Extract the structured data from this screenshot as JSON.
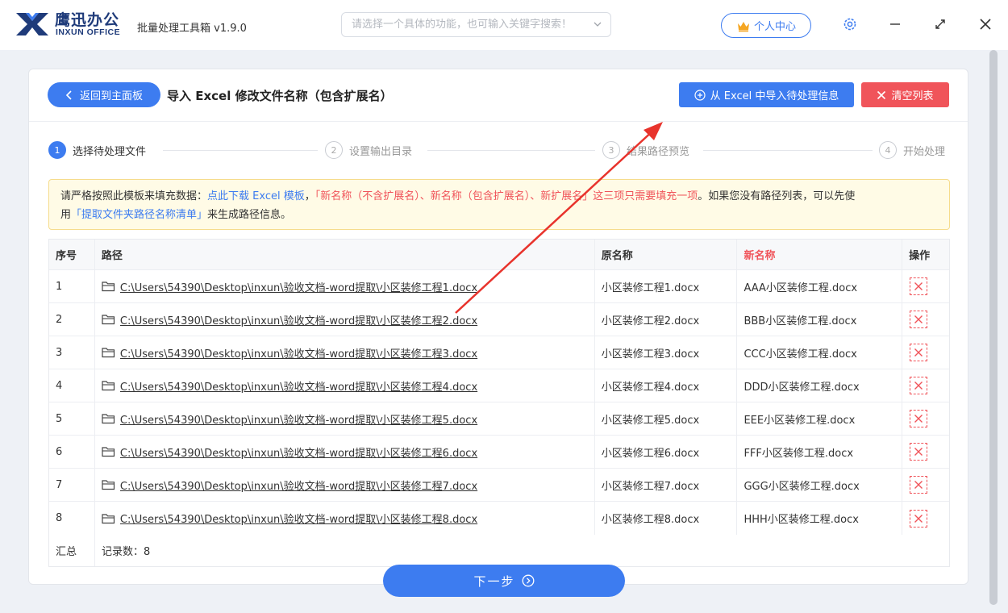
{
  "titlebar": {
    "brand_cn": "鹰迅办公",
    "brand_en": "INXUN OFFICE",
    "app_title": "批量处理工具箱 v1.9.0",
    "search_placeholder": "请选择一个具体的功能，也可输入关键字搜索！",
    "personal_center": "个人中心"
  },
  "header": {
    "back_label": "返回到主面板",
    "page_title": "导入 Excel 修改文件名称（包含扩展名）",
    "import_label": "从 Excel 中导入待处理信息",
    "clear_label": "清空列表"
  },
  "steps": [
    {
      "num": "1",
      "label": "选择待处理文件"
    },
    {
      "num": "2",
      "label": "设置输出目录"
    },
    {
      "num": "3",
      "label": "结果路径预览"
    },
    {
      "num": "4",
      "label": "开始处理"
    }
  ],
  "notice": {
    "p1": "请严格按照此模板来填充数据：",
    "link1": "点此下载 Excel 模板",
    "p2": "，",
    "red": "「新名称（不含扩展名）、新名称（包含扩展名）、新扩展名」这三项只需要填充一项",
    "p3": "。如果您没有路径列表，可以先使",
    "p4": "用",
    "link2": "「提取文件夹路径名称清单」",
    "p5": "来生成路径信息。"
  },
  "table": {
    "headers": {
      "index": "序号",
      "path": "路径",
      "orig": "原名称",
      "new": "新名称",
      "op": "操作"
    },
    "rows": [
      {
        "index": "1",
        "path": "C:\\Users\\54390\\Desktop\\inxun\\验收文档-word提取\\小区装修工程1.docx",
        "orig": "小区装修工程1.docx",
        "new": "AAA小区装修工程.docx"
      },
      {
        "index": "2",
        "path": "C:\\Users\\54390\\Desktop\\inxun\\验收文档-word提取\\小区装修工程2.docx",
        "orig": "小区装修工程2.docx",
        "new": "BBB小区装修工程.docx"
      },
      {
        "index": "3",
        "path": "C:\\Users\\54390\\Desktop\\inxun\\验收文档-word提取\\小区装修工程3.docx",
        "orig": "小区装修工程3.docx",
        "new": "CCC小区装修工程.docx"
      },
      {
        "index": "4",
        "path": "C:\\Users\\54390\\Desktop\\inxun\\验收文档-word提取\\小区装修工程4.docx",
        "orig": "小区装修工程4.docx",
        "new": "DDD小区装修工程.docx"
      },
      {
        "index": "5",
        "path": "C:\\Users\\54390\\Desktop\\inxun\\验收文档-word提取\\小区装修工程5.docx",
        "orig": "小区装修工程5.docx",
        "new": "EEE小区装修工程.docx"
      },
      {
        "index": "6",
        "path": "C:\\Users\\54390\\Desktop\\inxun\\验收文档-word提取\\小区装修工程6.docx",
        "orig": "小区装修工程6.docx",
        "new": "FFF小区装修工程.docx"
      },
      {
        "index": "7",
        "path": "C:\\Users\\54390\\Desktop\\inxun\\验收文档-word提取\\小区装修工程7.docx",
        "orig": "小区装修工程7.docx",
        "new": "GGG小区装修工程.docx"
      },
      {
        "index": "8",
        "path": "C:\\Users\\54390\\Desktop\\inxun\\验收文档-word提取\\小区装修工程8.docx",
        "orig": "小区装修工程8.docx",
        "new": "HHH小区装修工程.docx"
      }
    ],
    "summary_label": "汇总",
    "summary_value": "记录数：8"
  },
  "footer": {
    "next_label": "下一步"
  },
  "colors": {
    "primary": "#3d7cf0",
    "danger": "#f0545a",
    "notice_bg": "#fffbe6"
  }
}
